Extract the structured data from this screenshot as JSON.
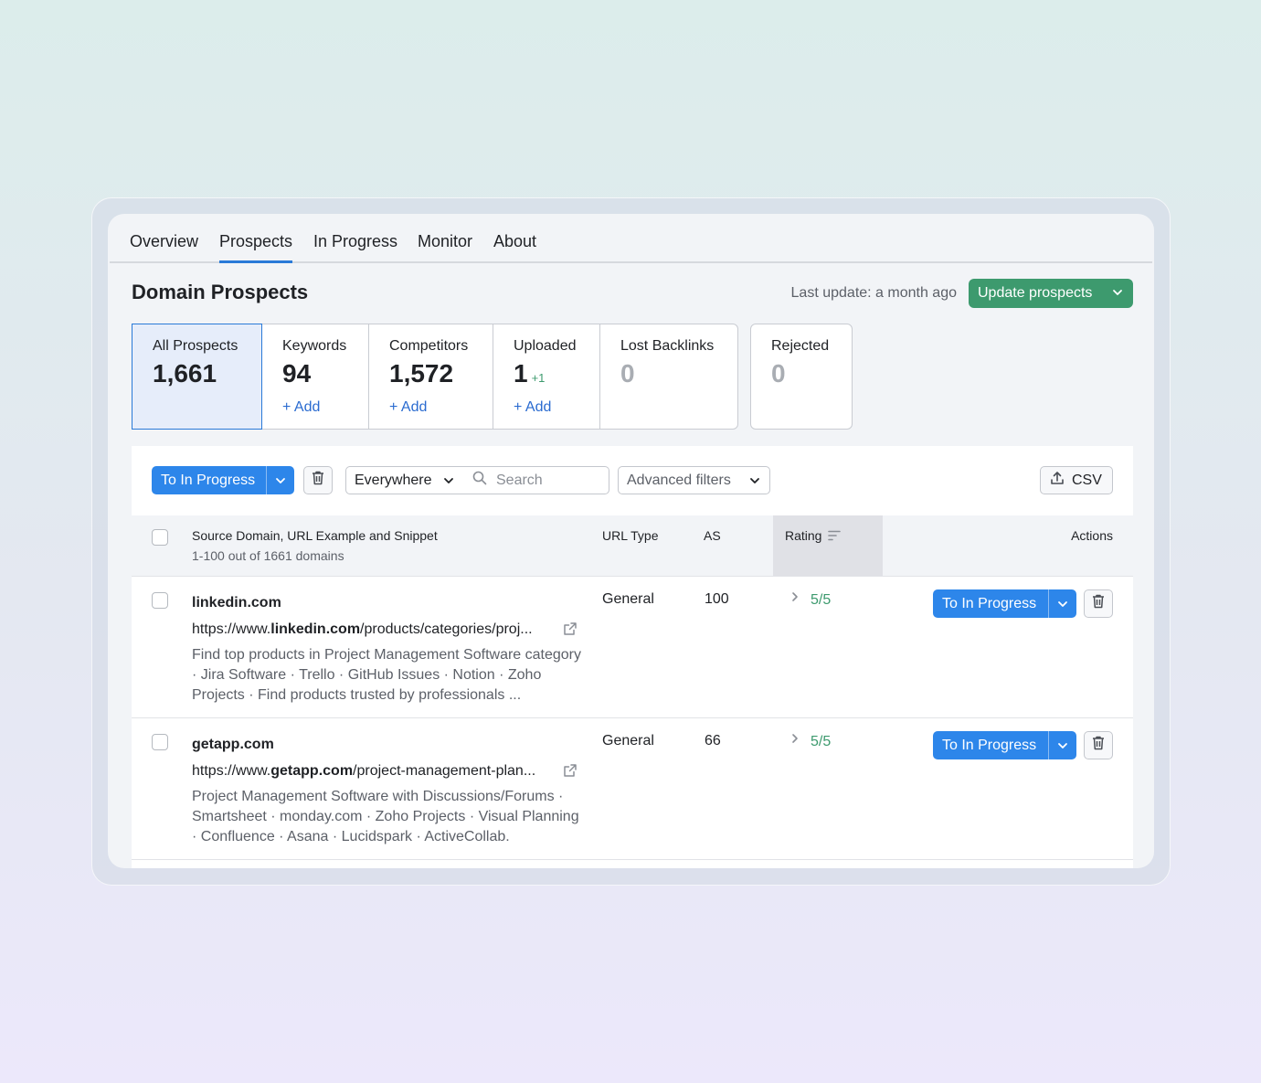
{
  "tabs": [
    {
      "label": "Overview"
    },
    {
      "label": "Prospects"
    },
    {
      "label": "In Progress"
    },
    {
      "label": "Monitor"
    },
    {
      "label": "About"
    }
  ],
  "active_tab": "Prospects",
  "header": {
    "title": "Domain Prospects",
    "last_update": "Last update: a month ago",
    "update_button": "Update prospects"
  },
  "cards": [
    {
      "label": "All Prospects",
      "value": "1,661"
    },
    {
      "label": "Keywords",
      "value": "94",
      "add": "+ Add"
    },
    {
      "label": "Competitors",
      "value": "1,572",
      "add": "+ Add"
    },
    {
      "label": "Uploaded",
      "value": "1",
      "delta": "+1",
      "add": "+ Add"
    },
    {
      "label": "Lost Backlinks",
      "value": "0"
    },
    {
      "label": "Rejected",
      "value": "0"
    }
  ],
  "toolbar": {
    "to_in_progress": "To In Progress",
    "scope": "Everywhere",
    "search_placeholder": "Search",
    "advanced_filters": "Advanced filters",
    "csv": "CSV"
  },
  "table": {
    "columns": {
      "source": "Source Domain, URL Example and Snippet",
      "source_sub": "1-100 out of 1661 domains",
      "url_type": "URL Type",
      "as": "AS",
      "rating": "Rating",
      "actions": "Actions"
    },
    "rows": [
      {
        "domain": "linkedin.com",
        "url_prefix": "https://www.",
        "url_domain": "linkedin.com",
        "url_suffix": "/products/categories/proj...",
        "snippet": "Find top products in Project Management Software category · Jira Software · Trello · GitHub Issues · Notion · Zoho Projects · Find products trusted by professionals ...",
        "url_type": "General",
        "as": "100",
        "rating": "5/5",
        "action": "To In Progress"
      },
      {
        "domain": "getapp.com",
        "url_prefix": "https://www.",
        "url_domain": "getapp.com",
        "url_suffix": "/project-management-plan...",
        "snippet": "Project Management Software with Discussions/Forums · Smartsheet · monday.com · Zoho Projects · Visual Planning · Confluence · Asana · Lucidspark · ActiveCollab.",
        "url_type": "General",
        "as": "66",
        "rating": "5/5",
        "action": "To In Progress"
      }
    ]
  },
  "colors": {
    "primary_blue": "#2d86ea",
    "green": "#3d9a6e",
    "link_blue": "#2a6bd0",
    "active_tab_underline": "#2a7ad8"
  }
}
